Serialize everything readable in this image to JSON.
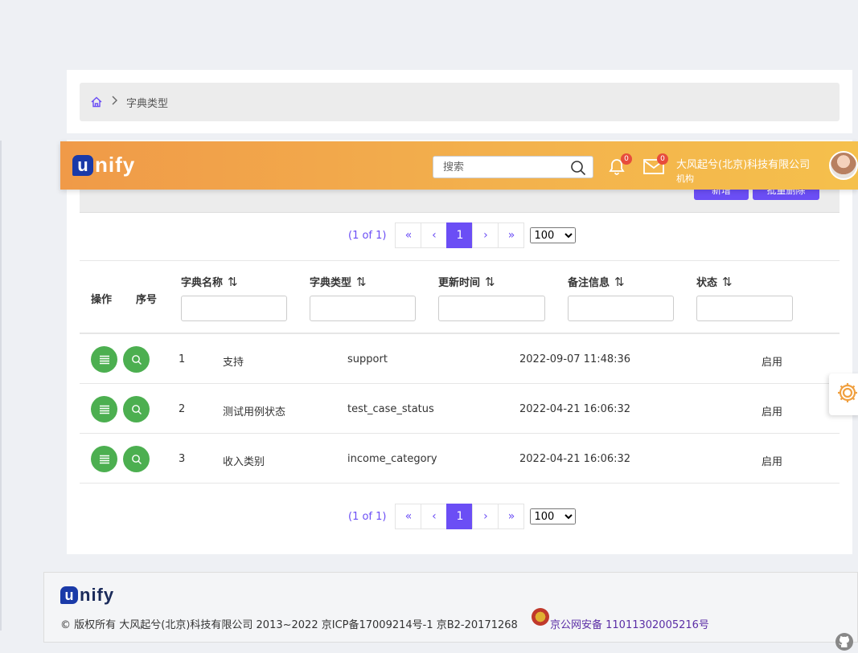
{
  "breadcrumb": {
    "current": "字典类型"
  },
  "topbar": {
    "logo_first": "u",
    "logo_rest": "nify",
    "search_placeholder": "搜索",
    "notifications_count": "0",
    "messages_count": "0",
    "org_name": "大风起兮(北京)科技有限公司",
    "org_type": "机构"
  },
  "toolbar": {
    "buttons": [
      "新增",
      "批量删除"
    ]
  },
  "paginator": {
    "report": "(1 of 1)",
    "first": "«",
    "prev": "‹",
    "page": "1",
    "next": "›",
    "last": "»",
    "rows_per_page": "100"
  },
  "table": {
    "headers": {
      "action": "操作",
      "index": "序号",
      "name": "字典名称",
      "type": "字典类型",
      "updated": "更新时间",
      "remark": "备注信息",
      "status": "状态"
    },
    "sort_icon": "⇅",
    "rows": [
      {
        "index": "1",
        "name": "支持",
        "type": "support",
        "updated": "2022-09-07 11:48:36",
        "remark": "",
        "status": "启用"
      },
      {
        "index": "2",
        "name": "测试用例状态",
        "type": "test_case_status",
        "updated": "2022-04-21 16:06:32",
        "remark": "",
        "status": "启用"
      },
      {
        "index": "3",
        "name": "收入类别",
        "type": "income_category",
        "updated": "2022-04-21 16:06:32",
        "remark": "",
        "status": "启用"
      }
    ]
  },
  "footer": {
    "logo_first": "u",
    "logo_rest": "nify",
    "copyright": "© 版权所有 大风起兮(北京)科技有限公司 2013~2022 京ICP备17009214号-1 京B2-20171268",
    "police_record": "京公网安备 11011302005216号"
  },
  "colors": {
    "primary": "#6b4ef5",
    "action_green": "#4caf50",
    "topbar_start": "#f09a48",
    "topbar_end": "#f5c04c",
    "gear": "#f0a040"
  },
  "icons": [
    "home-icon",
    "chevron-right-icon",
    "search-icon",
    "bell-icon",
    "mail-icon",
    "list-icon",
    "search-icon",
    "gear-icon",
    "github-icon",
    "police-badge-icon"
  ]
}
